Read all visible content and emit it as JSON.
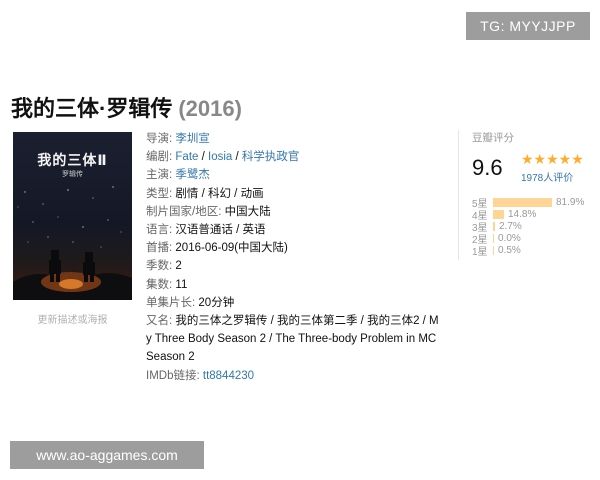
{
  "watermarks": {
    "top": "TG: MYYJJPP",
    "bottom": "www.ao-aggames.com"
  },
  "movie": {
    "title": "我的三体·罗辑传",
    "year": "(2016)"
  },
  "poster": {
    "title": "我的三体Ⅱ",
    "subtitle": "罗辑传",
    "update_link": "更新描述或海报"
  },
  "info": {
    "director_label": "导演:",
    "director": "李圳宣",
    "writer_label": "编剧:",
    "writers": [
      "Fate",
      "Iosia",
      "科学执政官"
    ],
    "cast_label": "主演:",
    "cast": "季鹭杰",
    "genre_label": "类型:",
    "genre": "剧情 / 科幻 / 动画",
    "country_label": "制片国家/地区:",
    "country": "中国大陆",
    "language_label": "语言:",
    "language": "汉语普通话 / 英语",
    "release_label": "首播:",
    "release": "2016-06-09(中国大陆)",
    "seasons_label": "季数:",
    "seasons": "2",
    "episodes_label": "集数:",
    "episodes": "11",
    "runtime_label": "单集片长:",
    "runtime": "20分钟",
    "aka_label": "又名:",
    "aka_line1": "我的三体之罗辑传 / 我的三体第二季 / 我的三体2 / M",
    "aka_line2": "y Three Body Season 2 / The Three-body Problem in MC",
    "aka_line3": "Season 2",
    "imdb_label": "IMDb链接:",
    "imdb": "tt8844230"
  },
  "rating": {
    "title": "豆瓣评分",
    "score": "9.6",
    "stars": "★★★★★",
    "votes": "1978人评价",
    "accent_color": "#ffac2d",
    "bar_color": "#ffd596",
    "breakdown": [
      {
        "label": "5星",
        "percent": "81.9%",
        "fraction": 0.819
      },
      {
        "label": "4星",
        "percent": "14.8%",
        "fraction": 0.148
      },
      {
        "label": "3星",
        "percent": "2.7%",
        "fraction": 0.027
      },
      {
        "label": "2星",
        "percent": "0.0%",
        "fraction": 0.0
      },
      {
        "label": "1星",
        "percent": "0.5%",
        "fraction": 0.005
      }
    ]
  }
}
